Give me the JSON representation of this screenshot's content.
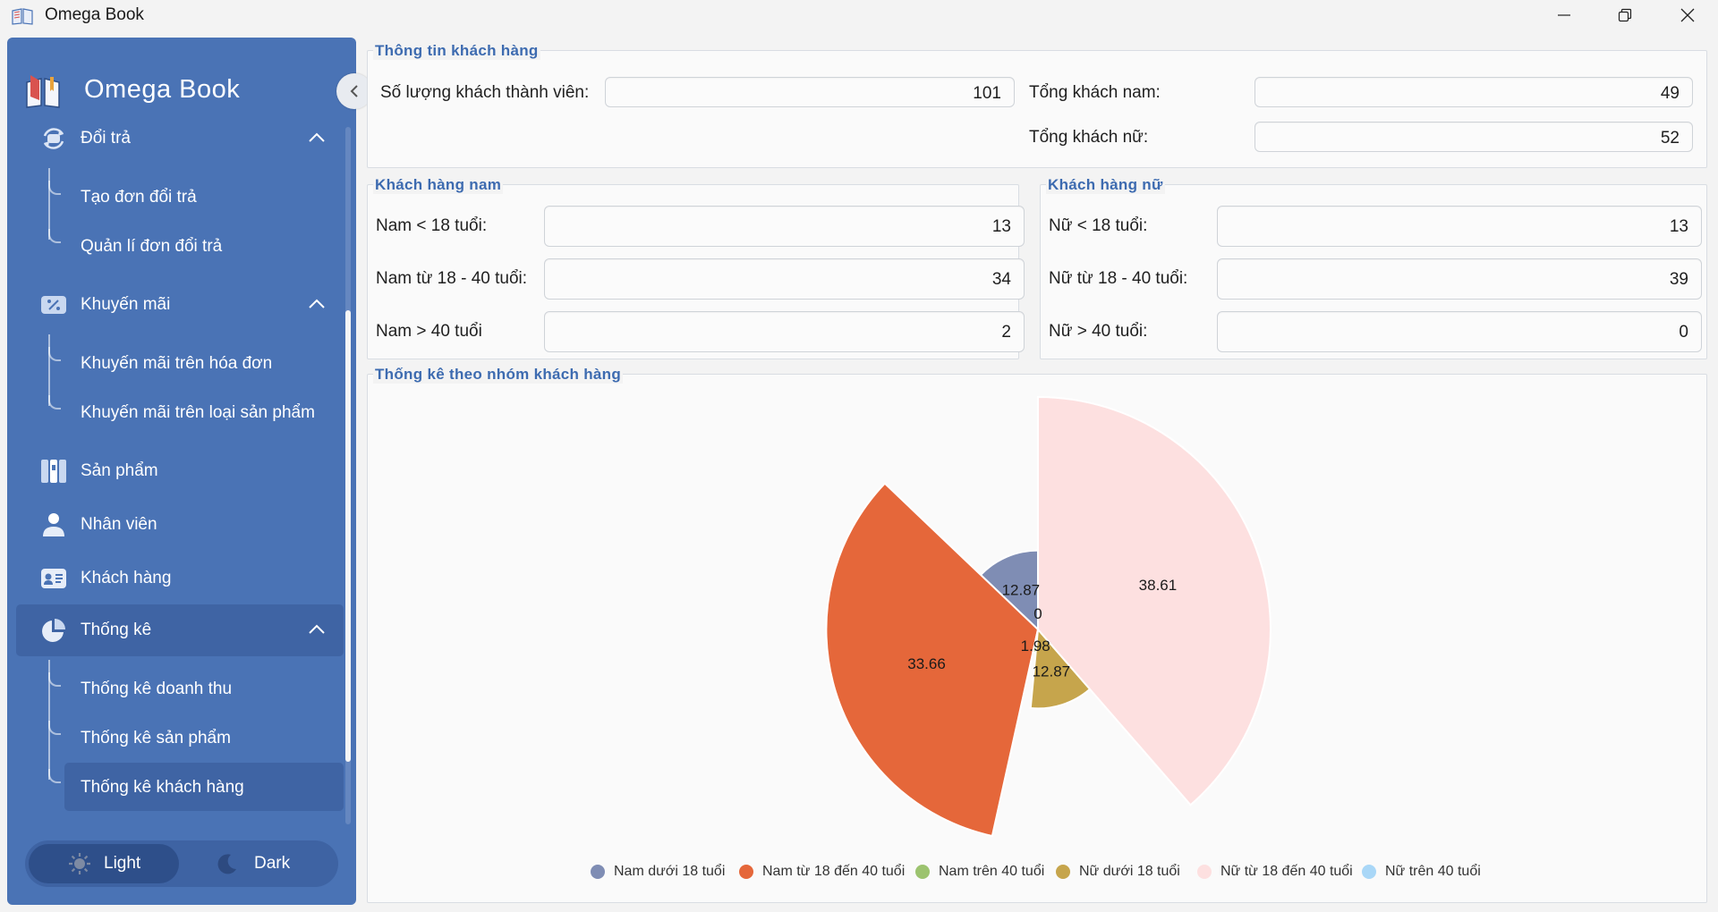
{
  "window": {
    "title": "Omega Book"
  },
  "sidebar": {
    "brand": "Omega Book",
    "menu": {
      "doi_tra": {
        "label": "Đổi trả",
        "children": [
          "Tạo đơn đổi trả",
          "Quản lí đơn đổi trả"
        ]
      },
      "khuyen_mai": {
        "label": "Khuyến mãi",
        "children": [
          "Khuyến mãi trên hóa đơn",
          "Khuyến mãi trên loại sản phẩm"
        ]
      },
      "san_pham": {
        "label": "Sản phẩm"
      },
      "nhan_vien": {
        "label": "Nhân viên"
      },
      "khach_hang": {
        "label": "Khách hàng"
      },
      "thong_ke": {
        "label": "Thống kê",
        "children": [
          "Thống kê doanh thu",
          "Thống kê sản phẩm",
          "Thống kê khách hàng"
        ]
      }
    },
    "theme": {
      "light": "Light",
      "dark": "Dark"
    }
  },
  "info": {
    "title": "Thông tin khách hàng",
    "members_label": "Số lượng khách thành viên:",
    "members_value": "101",
    "male_total_label": "Tổng khách nam:",
    "male_total_value": "49",
    "female_total_label": "Tổng khách nữ:",
    "female_total_value": "52"
  },
  "male": {
    "title": "Khách hàng nam",
    "rows": [
      {
        "label": "Nam < 18 tuổi:",
        "value": "13"
      },
      {
        "label": "Nam từ 18 - 40 tuổi:",
        "value": "34"
      },
      {
        "label": "Nam > 40 tuổi",
        "value": "2"
      }
    ]
  },
  "female": {
    "title": "Khách hàng nữ",
    "rows": [
      {
        "label": "Nữ < 18 tuổi:",
        "value": "13"
      },
      {
        "label": "Nữ từ 18 - 40 tuổi:",
        "value": "39"
      },
      {
        "label": "Nữ > 40 tuổi:",
        "value": "0"
      }
    ]
  },
  "stats": {
    "title": "Thống kê theo nhóm khách hàng"
  },
  "chart_data": {
    "type": "pie",
    "title": "",
    "categories": [
      "Nam dưới 18 tuổi",
      "Nam từ 18 đến 40 tuổi",
      "Nam trên 40 tuổi",
      "Nữ dưới 18 tuổi",
      "Nữ từ 18 đến 40 tuổi",
      "Nữ trên 40 tuổi"
    ],
    "values": [
      12.87,
      33.66,
      1.98,
      12.87,
      38.61,
      0
    ],
    "data_labels": [
      "12.87",
      "33.66",
      "1.98",
      "12.87",
      "38.61",
      "0"
    ],
    "colors": [
      "#7f8db4",
      "#e5673a",
      "#9cc36f",
      "#c6a54c",
      "#fde0e0",
      "#a9d7f7"
    ],
    "rose_radii_relative": [
      0.34,
      0.91,
      0.1,
      0.34,
      1.0,
      0.0
    ],
    "legend_position": "bottom"
  }
}
